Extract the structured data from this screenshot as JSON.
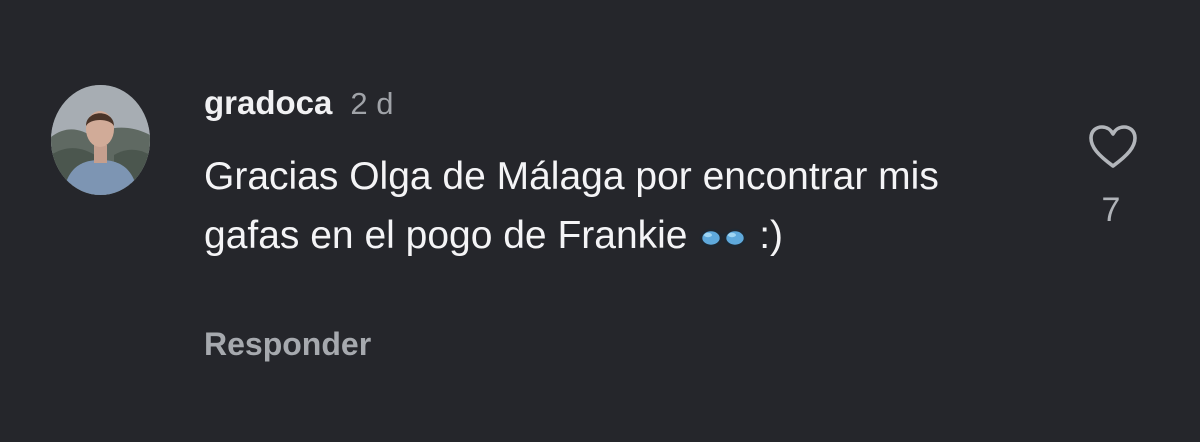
{
  "comment": {
    "username": "gradoca",
    "time": "2 d",
    "text_before_emoji": "Gracias Olga de Málaga por encontrar mis gafas en el pogo de Frankie",
    "emoji": "👓",
    "text_after_emoji": ":)",
    "reply_label": "Responder",
    "like_count": "7"
  },
  "icons": {
    "like": "heart-outline-icon",
    "emoji": "glasses-icon"
  },
  "colors": {
    "background": "#25262b",
    "primary_text": "#f4f4f6",
    "secondary_text": "#a6a9ae"
  }
}
